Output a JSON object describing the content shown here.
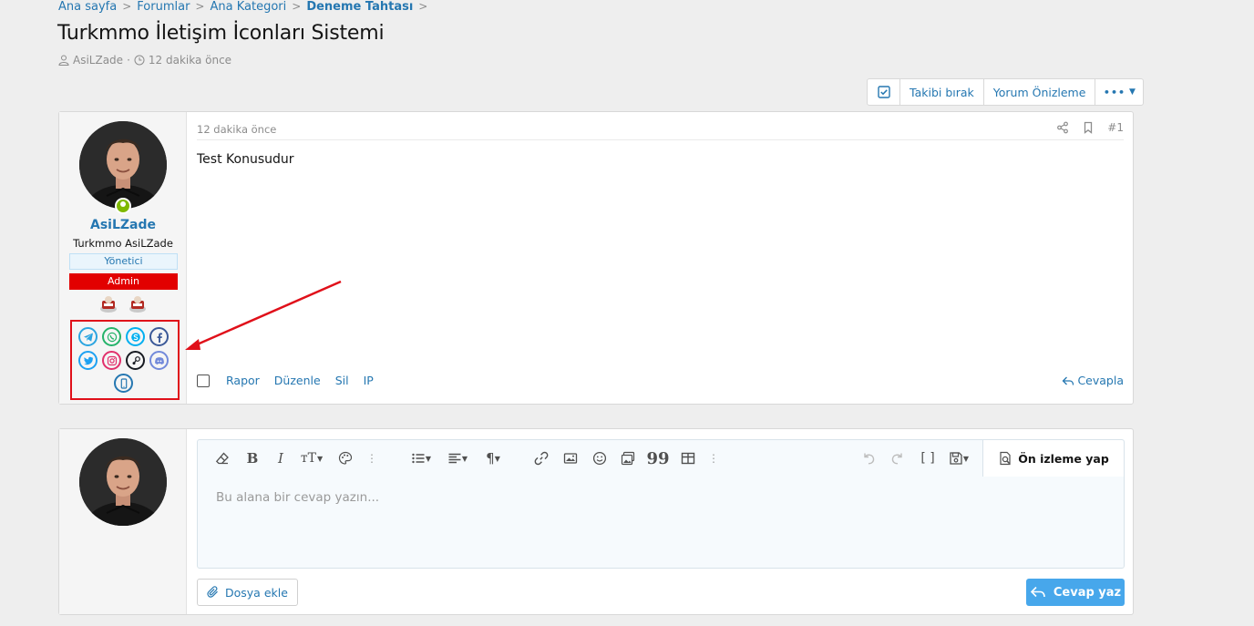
{
  "breadcrumb": {
    "items": [
      "Ana sayfa",
      "Forumlar",
      "Ana Kategori",
      "Deneme Tahtası"
    ]
  },
  "thread": {
    "title": "Turkmmo İletişim İconları Sistemi",
    "author": "AsiLZade",
    "time": "12 dakika önce"
  },
  "actions": {
    "unwatch": "Takibi bırak",
    "preview": "Yorum Önizleme",
    "more": "•••"
  },
  "post": {
    "date": "12 dakika önce",
    "number": "#1",
    "body": "Test Konusudur",
    "report": "Rapor",
    "edit": "Düzenle",
    "delete": "Sil",
    "ip": "IP",
    "reply": "Cevapla"
  },
  "user": {
    "name": "AsiLZade",
    "title": "Turkmmo AsiLZade",
    "banner_role": "Yönetici",
    "banner_admin": "Admin",
    "contacts": [
      {
        "icon": "telegram-icon",
        "color": "#2ca5e0"
      },
      {
        "icon": "whatsapp-icon",
        "color": "#25b36a"
      },
      {
        "icon": "skype-icon",
        "color": "#00aff0"
      },
      {
        "icon": "facebook-icon",
        "color": "#3b5998"
      },
      {
        "icon": "twitter-icon",
        "color": "#1da1f2"
      },
      {
        "icon": "instagram-icon",
        "color": "#e1306c"
      },
      {
        "icon": "steam-icon",
        "color": "#171a21"
      },
      {
        "icon": "discord-icon",
        "color": "#7289da"
      },
      {
        "icon": "phone-icon",
        "color": "#2577b1"
      }
    ]
  },
  "editor": {
    "placeholder": "Bu alana bir cevap yazın...",
    "preview_label": "Ön izleme yap",
    "attach_label": "Dosya ekle",
    "submit_label": "Cevap yaz"
  },
  "colors": {
    "link": "#2577b1",
    "admin_banner": "#e20000",
    "highlight": "#e0101a",
    "submit": "#47a7eb"
  }
}
